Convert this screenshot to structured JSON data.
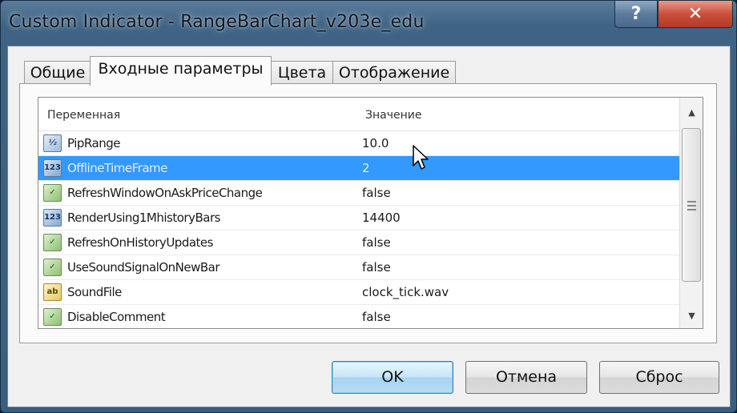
{
  "window": {
    "title": "Custom Indicator - RangeBarChart_v203e_edu",
    "help_glyph": "?",
    "close_glyph": "✕"
  },
  "tabs": [
    {
      "label": "Общие",
      "active": false
    },
    {
      "label": "Входные параметры",
      "active": true
    },
    {
      "label": "Цвета",
      "active": false
    },
    {
      "label": "Отображение",
      "active": false
    }
  ],
  "grid": {
    "col_variable": "Переменная",
    "col_value": "Значение",
    "rows": [
      {
        "icon": "double-param-icon",
        "badge": "½",
        "name": "PipRange",
        "value": "10.0"
      },
      {
        "icon": "integer-param-icon",
        "badge": "123",
        "name": "OfflineTimeFrame",
        "value": "2"
      },
      {
        "icon": "bool-param-icon",
        "badge": "✓",
        "name": "RefreshWindowOnAskPriceChange",
        "value": "false"
      },
      {
        "icon": "integer-param-icon",
        "badge": "123",
        "name": "RenderUsing1MhistoryBars",
        "value": "14400"
      },
      {
        "icon": "bool-param-icon",
        "badge": "✓",
        "name": "RefreshOnHistoryUpdates",
        "value": "false"
      },
      {
        "icon": "bool-param-icon",
        "badge": "✓",
        "name": "UseSoundSignalOnNewBar",
        "value": "false"
      },
      {
        "icon": "string-param-icon",
        "badge": "ab",
        "name": "SoundFile",
        "value": "clock_tick.wav"
      },
      {
        "icon": "bool-param-icon",
        "badge": "✓",
        "name": "DisableComment",
        "value": "false"
      }
    ],
    "selected_row": "OfflineTimeFrame"
  },
  "buttons": {
    "ok": "OK",
    "cancel": "Отмена",
    "reset": "Сброс"
  },
  "colors": {
    "selection": "#3399ff",
    "close_button": "#c9503c",
    "ok_button_border": "#3c7fb1"
  }
}
